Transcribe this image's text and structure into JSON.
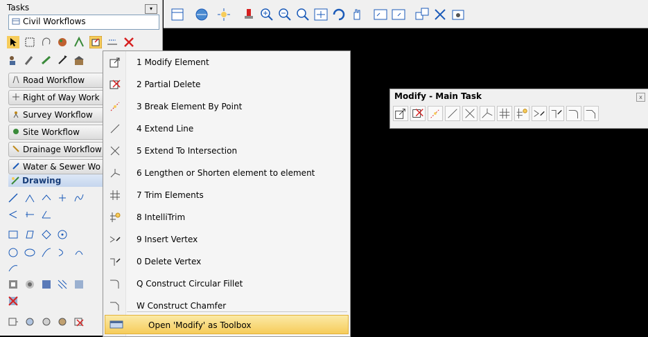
{
  "tasks": {
    "label": "Tasks",
    "dropdown_arrow": "▾",
    "selected": "Civil Workflows"
  },
  "workflows": [
    {
      "label": "Road Workflow",
      "icon": "road-icon"
    },
    {
      "label": "Right of Way Work",
      "icon": "row-icon"
    },
    {
      "label": "Survey Workflow",
      "icon": "survey-icon"
    },
    {
      "label": "Site Workflow",
      "icon": "site-icon"
    },
    {
      "label": "Drainage Workflow",
      "icon": "drainage-icon"
    },
    {
      "label": "Water & Sewer Wo",
      "icon": "water-icon"
    }
  ],
  "drawing": {
    "label": "Drawing"
  },
  "context_menu": {
    "items": [
      {
        "label": "1  Modify Element"
      },
      {
        "label": "2  Partial Delete"
      },
      {
        "label": "3  Break Element By Point"
      },
      {
        "label": "4  Extend Line"
      },
      {
        "label": "5  Extend To Intersection"
      },
      {
        "label": "6  Lengthen or Shorten element to element"
      },
      {
        "label": "7  Trim Elements"
      },
      {
        "label": "8  IntelliTrim"
      },
      {
        "label": "9  Insert Vertex"
      },
      {
        "label": "0  Delete Vertex"
      },
      {
        "label": "Q  Construct Circular Fillet"
      },
      {
        "label": "W  Construct Chamfer"
      }
    ],
    "toolbox_label": "Open 'Modify' as Toolbox"
  },
  "modify_box": {
    "title": "Modify - Main Task",
    "close": "x"
  },
  "colors": {
    "accent_red": "#d62020",
    "highlight": "#f6cc5b",
    "drawing_header": "#1a3f7a"
  }
}
